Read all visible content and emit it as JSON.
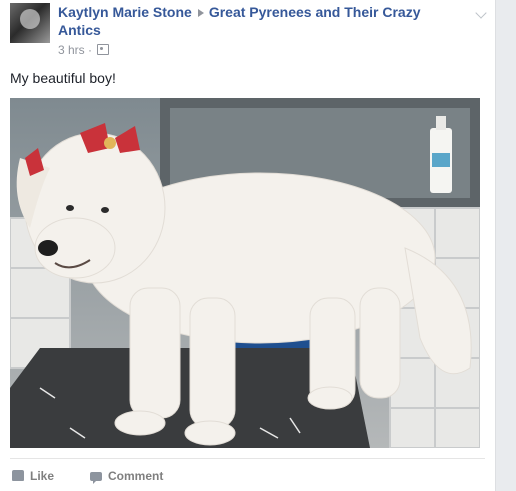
{
  "post": {
    "author": "Kaytlyn Marie Stone",
    "group": "Great Pyrenees and Their Crazy Antics",
    "time": "3 hrs",
    "separator": "·",
    "audience_icon": "group-audience-icon",
    "text": "My beautiful boy!",
    "photo": {
      "subject": "white dog on grooming table",
      "dog_color": "#f4f1ec",
      "bow_color": "#c9323a"
    }
  },
  "actions": {
    "like_label": "Like",
    "comment_label": "Comment"
  },
  "colors": {
    "link": "#365899",
    "meta": "#90949c",
    "action": "#7f7f7f",
    "background": "#e9ebee"
  }
}
